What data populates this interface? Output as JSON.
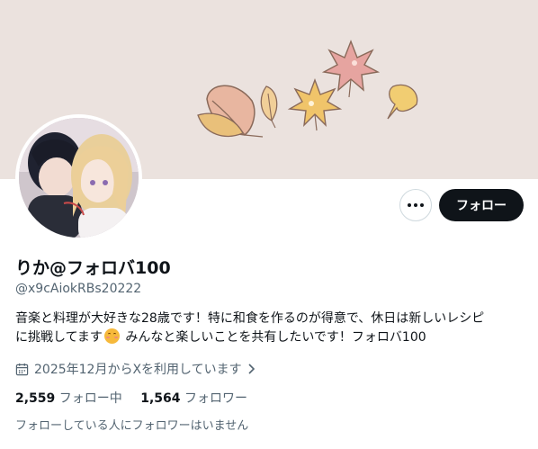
{
  "profile": {
    "display_name": "りか@フォロバ100",
    "handle": "@x9cAiokRBs20222",
    "bio_line1": "音楽と料理が大好きな28歳です！特に和食を作るのが得意で、休日は新しいレシピ",
    "bio_line2_a": "に挑戦してます",
    "bio_emoji": "smiling-face-icon",
    "bio_line2_b": " みんなと楽しいことを共有したいです！フォロバ100",
    "joined": "2025年12月からXを利用しています",
    "following_count": "2,559",
    "following_label": "フォロー中",
    "followers_count": "1,564",
    "followers_label": "フォロワー",
    "mutual_text": "フォローしている人にフォロワーはいません"
  },
  "actions": {
    "follow_label": "フォロー",
    "more_icon": "more-horizontal-icon"
  },
  "colors": {
    "banner_bg": "#ebe2de",
    "text_primary": "#0f1419",
    "text_secondary": "#536471",
    "button_dark": "#0f1419"
  }
}
